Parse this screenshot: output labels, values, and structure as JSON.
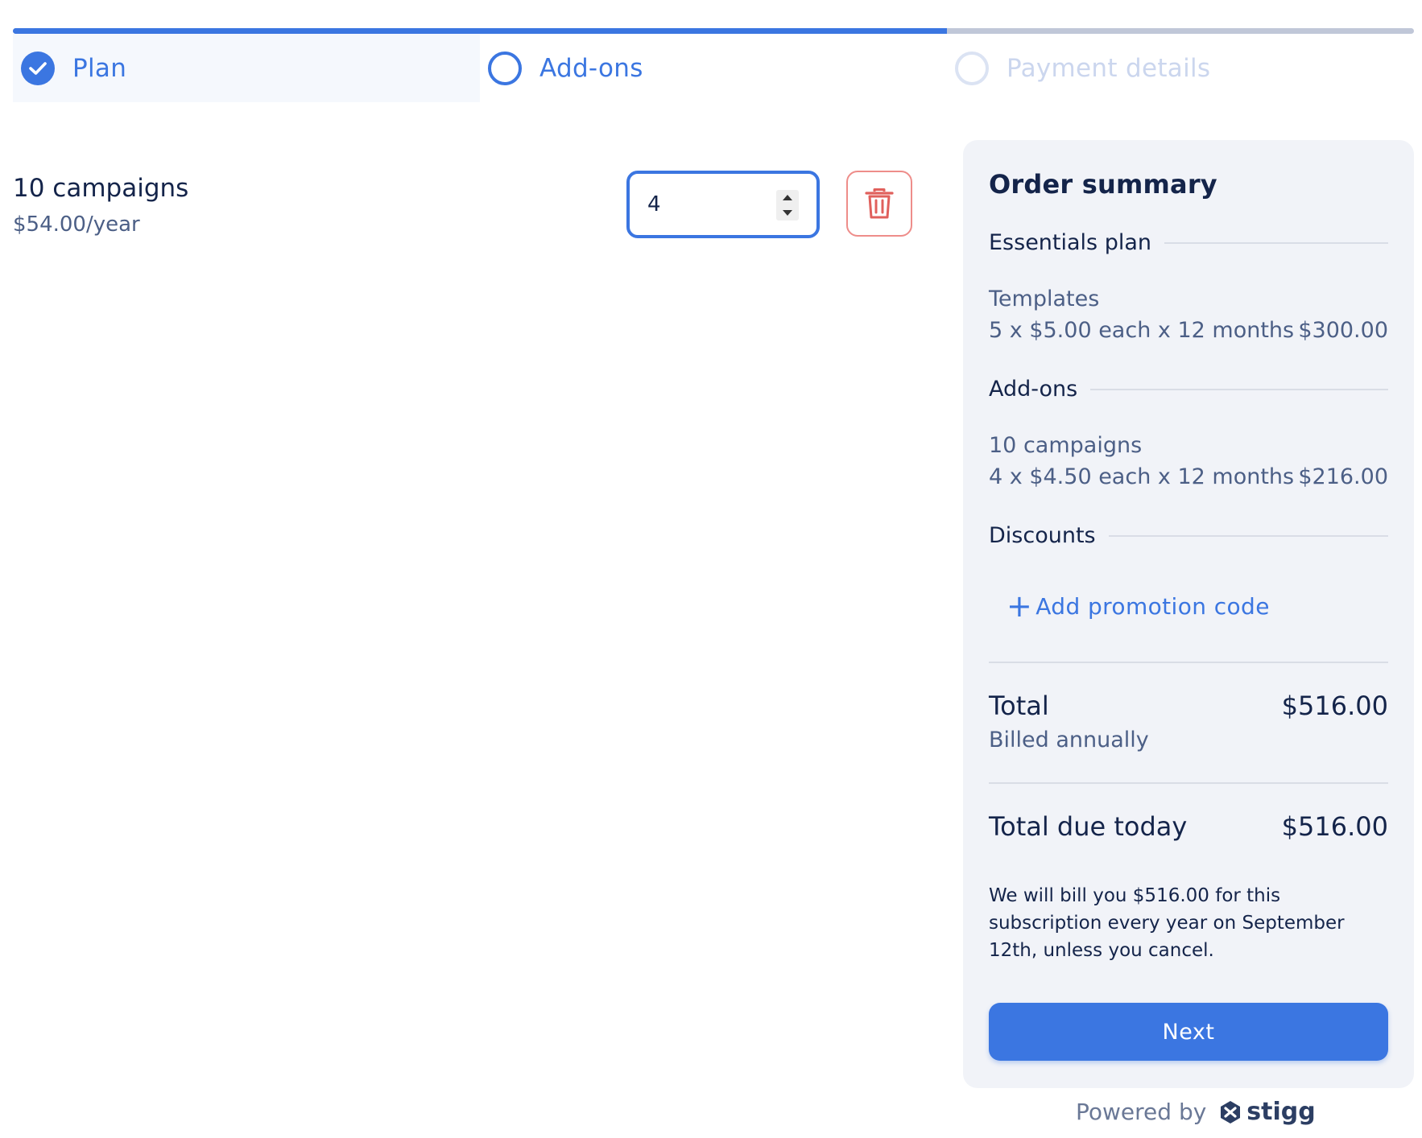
{
  "stepper": {
    "progress_fraction": 0.6667,
    "steps": [
      {
        "label": "Plan",
        "state": "completed"
      },
      {
        "label": "Add-ons",
        "state": "current"
      },
      {
        "label": "Payment details",
        "state": "upcoming"
      }
    ]
  },
  "addon": {
    "name": "10 campaigns",
    "price": "$54.00/year",
    "quantity": "4",
    "delete_icon": "trash-icon"
  },
  "summary": {
    "title": "Order summary",
    "plan_section": "Essentials plan",
    "plan_item": {
      "name": "Templates",
      "detail": "5 x $5.00 each x 12 months",
      "amount": "$300.00"
    },
    "addons_section": "Add-ons",
    "addon_item": {
      "name": "10 campaigns",
      "detail": "4 x $4.50 each x 12 months",
      "amount": "$216.00"
    },
    "discounts_section": "Discounts",
    "promo_label": "Add promotion code",
    "total_label": "Total",
    "total_amount": "$516.00",
    "billing_period": "Billed annually",
    "due_today_label": "Total due today",
    "due_today_amount": "$516.00",
    "note": "We will bill you $516.00 for this subscription every year on September 12th, unless you cancel.",
    "next_label": "Next"
  },
  "footer": {
    "powered_by": "Powered by",
    "brand": "stigg"
  },
  "colors": {
    "accent": "#3b76e1",
    "danger": "#e0605c",
    "card_bg": "#f1f3f8"
  }
}
